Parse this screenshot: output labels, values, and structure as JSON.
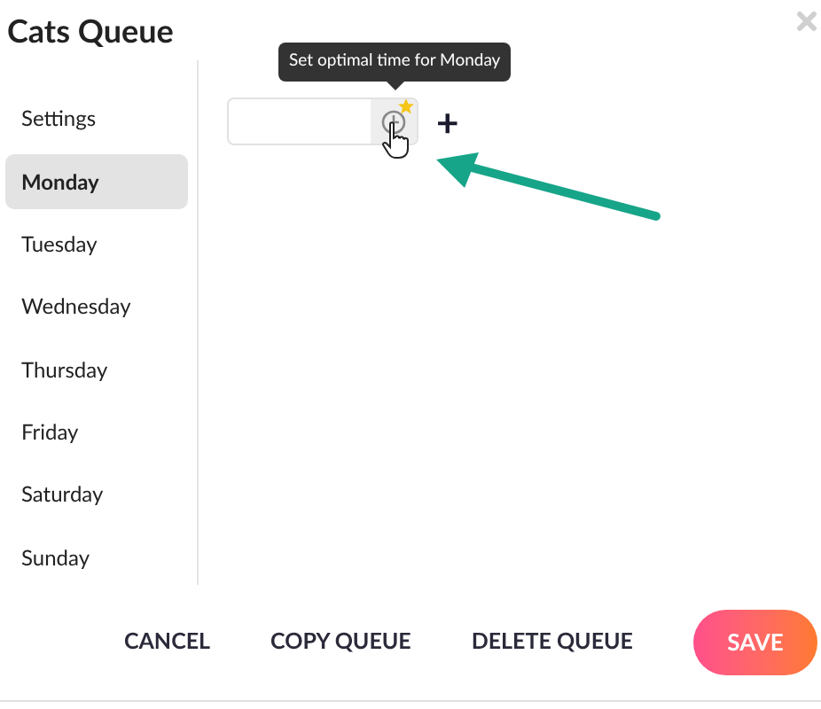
{
  "dialog": {
    "title": "Cats Queue"
  },
  "sidebar": {
    "items": [
      {
        "label": "Settings",
        "selected": false
      },
      {
        "label": "Monday",
        "selected": true
      },
      {
        "label": "Tuesday",
        "selected": false
      },
      {
        "label": "Wednesday",
        "selected": false
      },
      {
        "label": "Thursday",
        "selected": false
      },
      {
        "label": "Friday",
        "selected": false
      },
      {
        "label": "Saturday",
        "selected": false
      },
      {
        "label": "Sunday",
        "selected": false
      }
    ]
  },
  "tooltip": {
    "text": "Set optimal time for Monday"
  },
  "add_symbol": "+",
  "buttons": [
    {
      "label": "CANCEL",
      "kind": "text"
    },
    {
      "label": "COPY QUEUE",
      "kind": "text"
    },
    {
      "label": "DELETE QUEUE",
      "kind": "text"
    },
    {
      "label": "SAVE",
      "kind": "primary"
    }
  ]
}
